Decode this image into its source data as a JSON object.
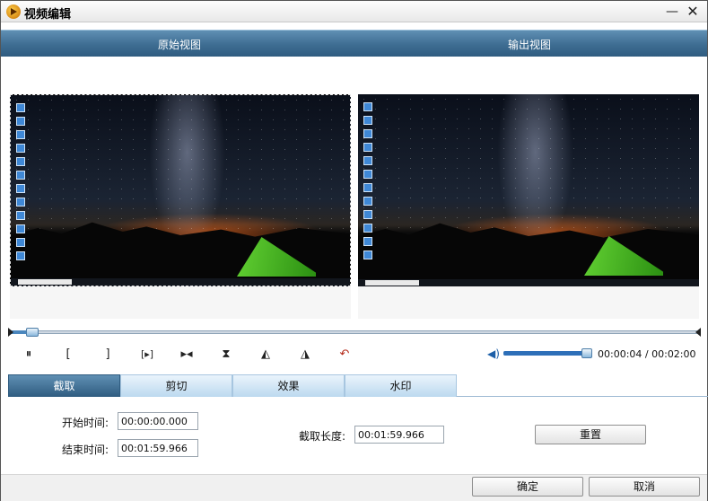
{
  "window": {
    "title": "视频编辑"
  },
  "view_header": {
    "original_label": "原始视图",
    "output_label": "输出视图"
  },
  "playback": {
    "position_fraction": 0.033,
    "volume_fraction": 0.95,
    "current_time": "00:00:04",
    "total_time": "00:02:00",
    "separator": " / "
  },
  "controls": {
    "pause": "⏸",
    "mark_in": "[",
    "mark_out": "]",
    "next_frame": "[▸]",
    "skip": "▸◂",
    "flip_vertical": "⧗",
    "rotate_left": "◭",
    "rotate_right": "◮",
    "undo": "↶"
  },
  "tabs": [
    {
      "label": "截取",
      "active": true
    },
    {
      "label": "剪切",
      "active": false
    },
    {
      "label": "效果",
      "active": false
    },
    {
      "label": "水印",
      "active": false
    }
  ],
  "trim": {
    "start_label": "开始时间:",
    "start_value": "00:00:00.000",
    "end_label": "结束时间:",
    "end_value": "00:01:59.966",
    "length_label": "截取长度:",
    "length_value": "00:01:59.966",
    "reset_label": "重置"
  },
  "footer": {
    "ok_label": "确定",
    "cancel_label": "取消"
  },
  "colors": {
    "accent": "#2f5c80",
    "tab_active": "#3e6d92",
    "volume": "#2d6fb8"
  }
}
